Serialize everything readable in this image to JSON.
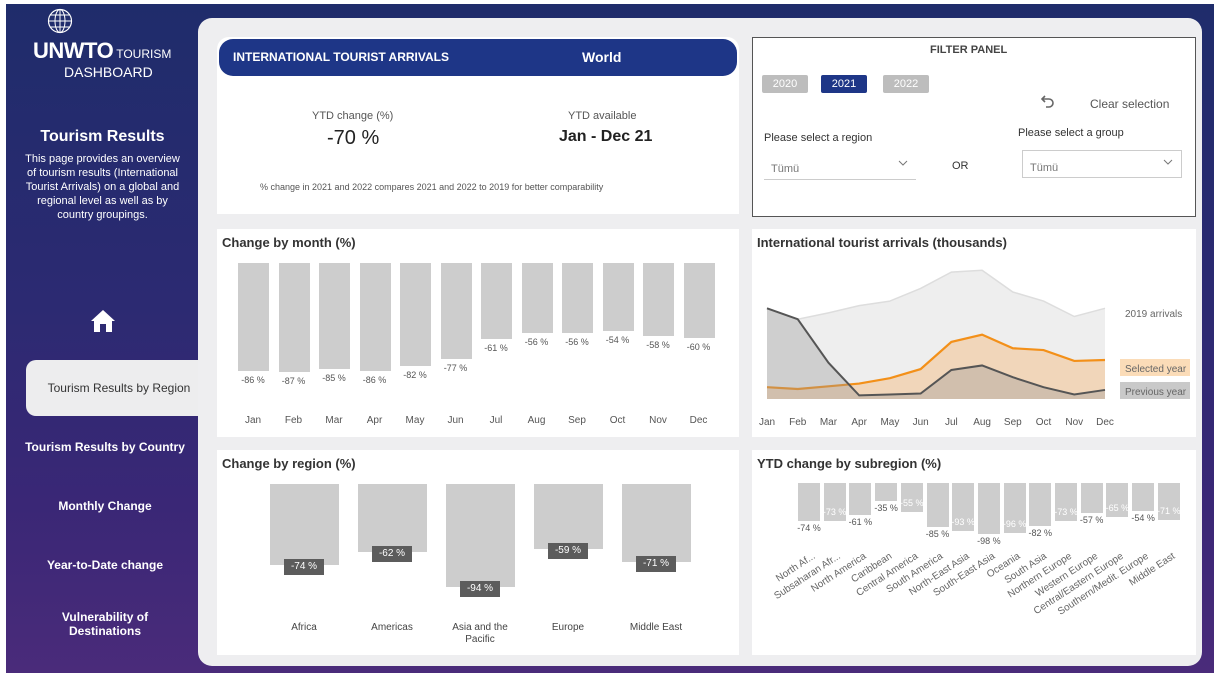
{
  "brand": {
    "name": "UNWTO",
    "name_suffix": "TOURISM",
    "subtitle": "DASHBOARD"
  },
  "sidebar": {
    "title": "Tourism Results",
    "description": "This page provides an overview of tourism results (International Tourist Arrivals) on a global and regional level as well as by country groupings.",
    "nav": [
      {
        "label": "Tourism Results by Region",
        "active": true
      },
      {
        "label": "Tourism Results by Country",
        "active": false
      },
      {
        "label": "Monthly Change",
        "active": false
      },
      {
        "label": "Year-to-Date change",
        "active": false
      },
      {
        "label": "Vulnerability of Destinations",
        "active": false
      }
    ]
  },
  "header": {
    "title": "INTERNATIONAL TOURIST ARRIVALS",
    "scope": "World"
  },
  "kpi": {
    "ytd_change_label": "YTD change (%)",
    "ytd_change_value": "-70 %",
    "ytd_available_label": "YTD available",
    "ytd_available_value": "Jan - Dec 21",
    "note": "% change in 2021 and 2022 compares 2021 and 2022  to 2019 for better comparability"
  },
  "filter": {
    "title": "FILTER PANEL",
    "years": [
      {
        "label": "2020",
        "selected": false
      },
      {
        "label": "2021",
        "selected": true
      },
      {
        "label": "2022",
        "selected": false
      }
    ],
    "clear_label": "Clear selection",
    "region_label": "Please select a region",
    "region_value": "Tümü",
    "or_label": "OR",
    "group_label": "Please select a group",
    "group_value": "Tümü"
  },
  "colors": {
    "header": "#1e3687",
    "bar": "#cdcdcd",
    "selected_year": "#f39019",
    "previous_year": "#555555",
    "arrivals_2019": "#e6e6e6"
  },
  "charts": {
    "month_title": "Change by month (%)",
    "arrivals_title": "International tourist arrivals (thousands)",
    "region_title": "Change by region (%)",
    "subregion_title": "YTD change by subregion (%)"
  },
  "chart_data": [
    {
      "type": "bar",
      "title": "Change by month (%)",
      "categories": [
        "Jan",
        "Feb",
        "Mar",
        "Apr",
        "May",
        "Jun",
        "Jul",
        "Aug",
        "Sep",
        "Oct",
        "Nov",
        "Dec"
      ],
      "values": [
        -86,
        -87,
        -85,
        -86,
        -82,
        -77,
        -61,
        -56,
        -56,
        -54,
        -58,
        -60
      ],
      "value_labels": [
        "-86 %",
        "-87 %",
        "-85 %",
        "-86 %",
        "-82 %",
        "-77 %",
        "-61 %",
        "-56 %",
        "-56 %",
        "-54 %",
        "-58 %",
        "-60 %"
      ],
      "ylim": [
        -100,
        0
      ]
    },
    {
      "type": "area",
      "title": "International tourist arrivals (thousands)",
      "categories": [
        "Jan",
        "Feb",
        "Mar",
        "Apr",
        "May",
        "Jun",
        "Jul",
        "Aug",
        "Sep",
        "Oct",
        "Nov",
        "Dec"
      ],
      "series": [
        {
          "name": "2019 arrivals",
          "values": [
            100,
            88,
            95,
            103,
            108,
            122,
            140,
            142,
            118,
            108,
            91,
            100
          ]
        },
        {
          "name": "Selected year",
          "values": [
            13,
            11,
            14,
            17,
            23,
            33,
            63,
            71,
            56,
            54,
            42,
            43
          ]
        },
        {
          "name": "Previous year",
          "values": [
            100,
            88,
            40,
            4,
            5,
            6,
            32,
            37,
            24,
            13,
            5,
            10
          ]
        }
      ],
      "ylim": [
        0,
        150
      ]
    },
    {
      "type": "bar",
      "title": "Change by region (%)",
      "categories": [
        "Africa",
        "Americas",
        "Asia and the Pacific",
        "Europe",
        "Middle East"
      ],
      "values": [
        -74,
        -62,
        -94,
        -59,
        -71
      ],
      "value_labels": [
        "-74 %",
        "-62 %",
        "-94 %",
        "-59 %",
        "-71 %"
      ],
      "ylim": [
        -100,
        0
      ]
    },
    {
      "type": "bar",
      "title": "YTD change by subregion (%)",
      "categories": [
        "North Af...",
        "Subsaharan Afr...",
        "North America",
        "Caribbean",
        "Central America",
        "South America",
        "North-East Asia",
        "South-East Asia",
        "Oceania",
        "South Asia",
        "Northern Europe",
        "Western Europe",
        "Central/Eastern Europe",
        "Southern/Medit. Europe",
        "Middle East"
      ],
      "values": [
        -74,
        -73,
        -61,
        -35,
        -55,
        -85,
        -93,
        -98,
        -96,
        -82,
        -73,
        -57,
        -65,
        -54,
        -71
      ],
      "value_labels": [
        "-74 %",
        "-73 %",
        "-61 %",
        "-35 %",
        "-55 %",
        "-85 %",
        "-93 %",
        "-98 %",
        "-96 %",
        "-82 %",
        "-73 %",
        "-57 %",
        "-65 %",
        "-54 %",
        "-71 %"
      ],
      "inside_label": [
        false,
        true,
        false,
        false,
        true,
        false,
        true,
        false,
        true,
        false,
        true,
        false,
        true,
        false,
        true
      ],
      "ylim": [
        -100,
        0
      ]
    }
  ]
}
